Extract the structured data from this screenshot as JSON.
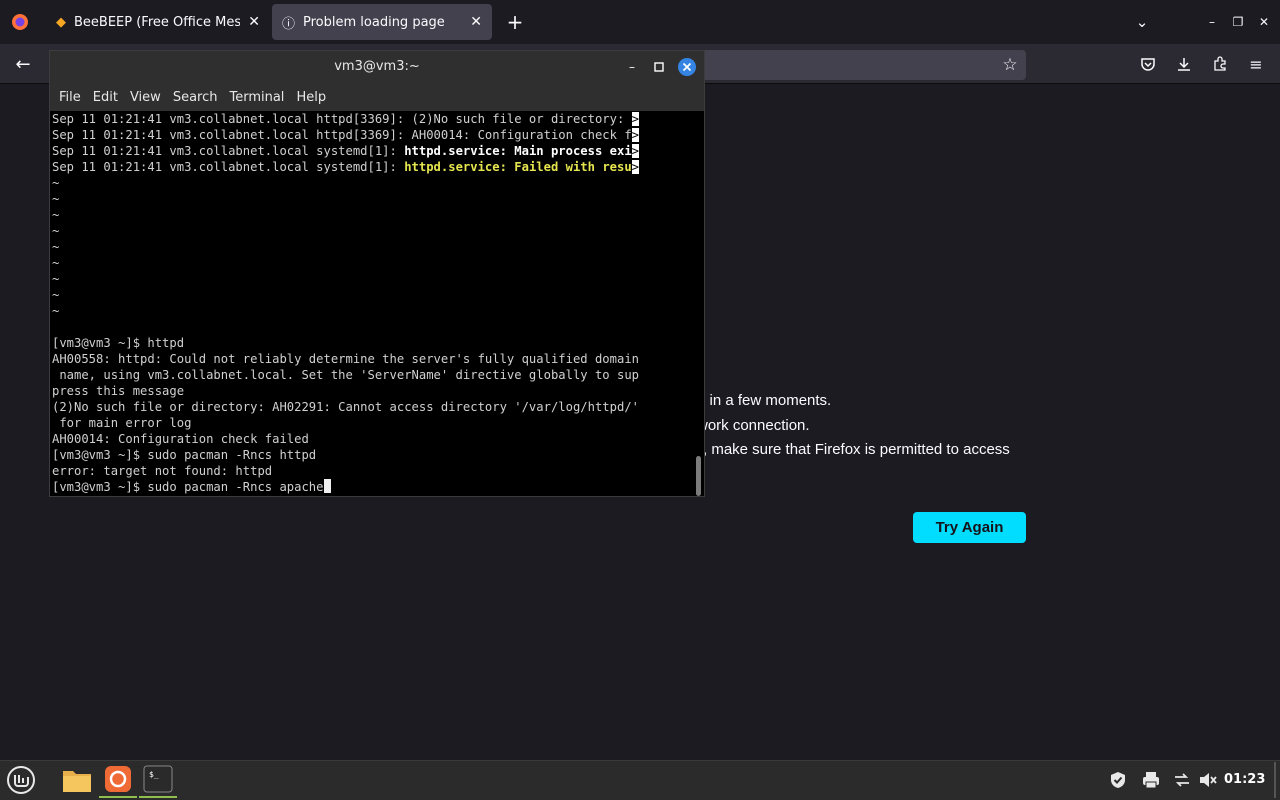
{
  "browser": {
    "tabs": [
      {
        "title": "BeeBEEP (Free Office Mess",
        "active": false,
        "icon": "beebeep-icon"
      },
      {
        "title": "Problem loading page",
        "active": true,
        "icon": "info-icon"
      }
    ],
    "new_tab": "+",
    "window_controls": {
      "minimize": "–",
      "maximize": "❐",
      "close": "✕"
    },
    "nav": {
      "back": "←",
      "bookmark": "☆"
    }
  },
  "error_page": {
    "lines": [
      "n in a few moments.",
      "work connection.",
      ", make sure that Firefox is permitted to access"
    ],
    "try_again": "Try Again",
    "accent": "#00ddff"
  },
  "terminal": {
    "title": "vm3@vm3:~",
    "menu": [
      "File",
      "Edit",
      "View",
      "Search",
      "Terminal",
      "Help"
    ],
    "log_lines": [
      {
        "prefix": "Sep 11 01:21:41 vm3.collabnet.local httpd[3369]: (2)No such file or directory: ",
        "bold": "",
        "yellow": "",
        "trunc": ">"
      },
      {
        "prefix": "Sep 11 01:21:41 vm3.collabnet.local httpd[3369]: AH00014: Configuration check f",
        "bold": "",
        "yellow": "",
        "trunc": ">"
      },
      {
        "prefix": "Sep 11 01:21:41 vm3.collabnet.local systemd[1]: ",
        "bold": "httpd.service: Main process exi",
        "yellow": "",
        "trunc": ">"
      },
      {
        "prefix": "Sep 11 01:21:41 vm3.collabnet.local systemd[1]: ",
        "bold": "",
        "yellow": "httpd.service: Failed with resu",
        "trunc": ">"
      }
    ],
    "tildes": [
      "~",
      "~",
      "~",
      "~",
      "~",
      "~",
      "~",
      "~",
      "~"
    ],
    "output_lines": [
      "[vm3@vm3 ~]$ httpd",
      "AH00558: httpd: Could not reliably determine the server's fully qualified domain",
      " name, using vm3.collabnet.local. Set the 'ServerName' directive globally to sup",
      "press this message",
      "(2)No such file or directory: AH02291: Cannot access directory '/var/log/httpd/'",
      " for main error log",
      "AH00014: Configuration check failed",
      "[vm3@vm3 ~]$ sudo pacman -Rncs httpd",
      "error: target not found: httpd"
    ],
    "current_command": "[vm3@vm3 ~]$ sudo pacman -Rncs apache"
  },
  "taskbar": {
    "clock": "01:23",
    "apps": [
      "menu-icon",
      "files-icon",
      "firefox-icon",
      "terminal-icon"
    ]
  }
}
